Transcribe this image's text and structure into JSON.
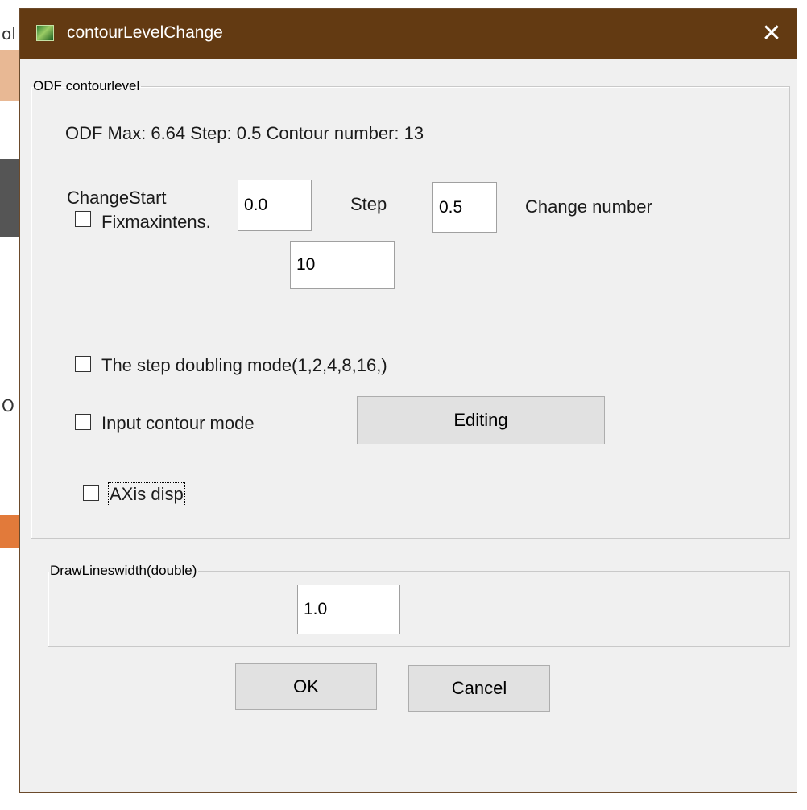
{
  "window": {
    "title": "contourLevelChange",
    "close_glyph": "✕",
    "icon": "app-icon",
    "titlebar_color": "#633a12"
  },
  "odf_group": {
    "legend": "ODF contourlevel",
    "info": "ODF Max: 6.64 Step: 0.5 Contour number: 13",
    "change_start_label": "ChangeStart",
    "change_start_value": "0.0",
    "step_label": "Step",
    "step_value": "0.5",
    "change_number_label": "Change number",
    "fixmax_label": "Fixmaxintens.",
    "fixmax_checked": false,
    "fixmax_value": "10",
    "step_doubling_label": "The step doubling mode(1,2,4,8,16,)",
    "step_doubling_checked": false,
    "input_contour_label": "Input contour mode",
    "input_contour_checked": false,
    "editing_button": "Editing",
    "axis_disp_label": "AXis disp",
    "axis_disp_checked": false
  },
  "line_group": {
    "legend": "DrawLineswidth(double)",
    "value": "1.0"
  },
  "buttons": {
    "ok": "OK",
    "cancel": "Cancel"
  }
}
